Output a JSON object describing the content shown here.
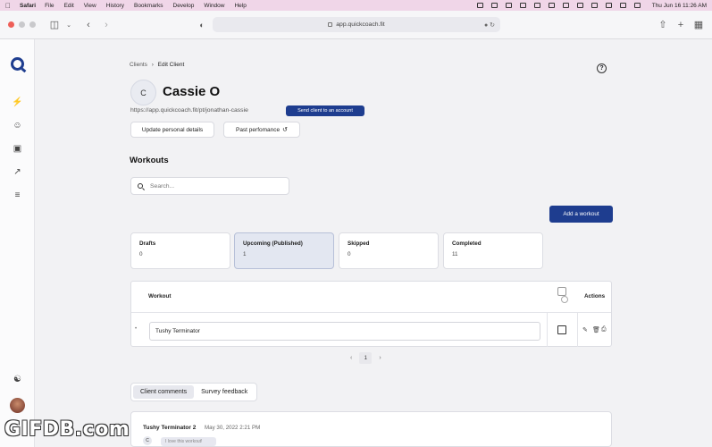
{
  "menubar": {
    "app_name": "Safari",
    "items": [
      "File",
      "Edit",
      "View",
      "History",
      "Bookmarks",
      "Develop",
      "Window",
      "Help"
    ],
    "clock": "Thu Jun 16  11:26 AM"
  },
  "browser": {
    "url": "app.quickcoach.fit"
  },
  "breadcrumb": {
    "parent": "Clients",
    "current": "Edit Client"
  },
  "client": {
    "initial": "C",
    "name": "Cassie O",
    "url": "https://app.quickcoach.fit/pt/jonathan-cassie",
    "send_button": "Send client to an account",
    "update_button": "Update personal details",
    "past_button": "Past perfomance"
  },
  "workouts": {
    "title": "Workouts",
    "search_placeholder": "Search...",
    "add_button": "Add a workout",
    "stats": [
      {
        "label": "Drafts",
        "value": "0"
      },
      {
        "label": "Upcoming (Published)",
        "value": "1"
      },
      {
        "label": "Skipped",
        "value": "0"
      },
      {
        "label": "Completed",
        "value": "11"
      }
    ],
    "table": {
      "col_workout": "Workout",
      "col_actions": "Actions",
      "rows": [
        {
          "name": "Tushy Terminator"
        }
      ]
    },
    "pagination": {
      "prev": "‹",
      "page": "1",
      "next": "›"
    }
  },
  "feedback": {
    "tabs": [
      "Client comments",
      "Survey feedback"
    ],
    "comment": {
      "author": "Tushy Terminator 2",
      "date": "May 30, 2022 2:21 PM",
      "avatar_initial": "C",
      "text": "I love this workout!"
    }
  },
  "watermark": "GIFDB.com",
  "colors": {
    "primary": "#1e3d8f",
    "menubar": "#f0d6e8"
  }
}
